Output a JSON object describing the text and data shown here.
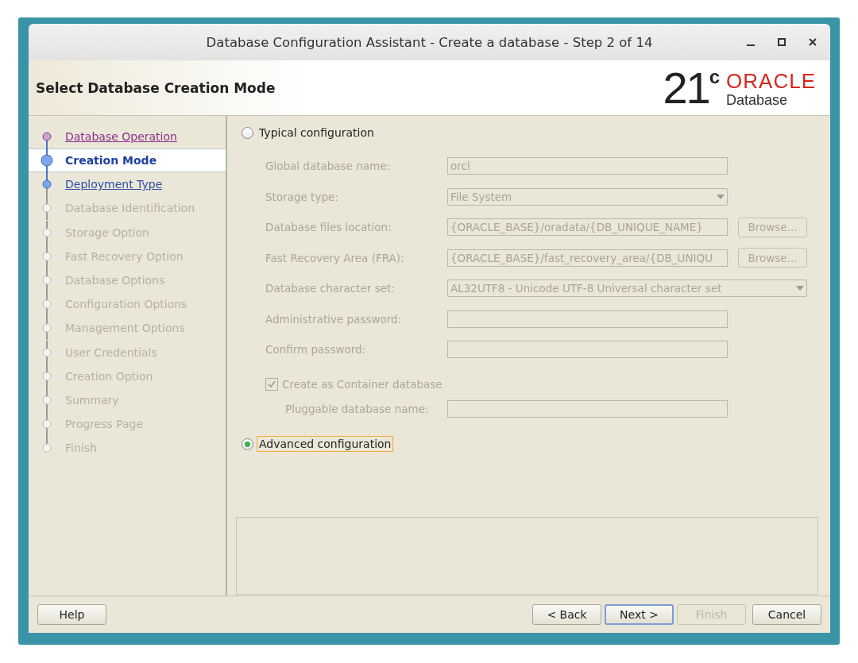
{
  "window": {
    "title": "Database Configuration Assistant - Create a database - Step 2 of 14"
  },
  "header": {
    "title": "Select Database Creation Mode",
    "logo": {
      "version": "21",
      "superscript": "c",
      "brand": "ORACLE",
      "product": "Database"
    }
  },
  "steps": [
    {
      "label": "Database Operation",
      "selected": false,
      "visited": true,
      "disabled": false
    },
    {
      "label": "Creation Mode",
      "selected": true,
      "visited": false,
      "disabled": false
    },
    {
      "label": "Deployment Type",
      "selected": false,
      "visited": false,
      "disabled": false
    },
    {
      "label": "Database Identification",
      "selected": false,
      "visited": false,
      "disabled": true
    },
    {
      "label": "Storage Option",
      "selected": false,
      "visited": false,
      "disabled": true
    },
    {
      "label": "Fast Recovery Option",
      "selected": false,
      "visited": false,
      "disabled": true
    },
    {
      "label": "Database Options",
      "selected": false,
      "visited": false,
      "disabled": true
    },
    {
      "label": "Configuration Options",
      "selected": false,
      "visited": false,
      "disabled": true
    },
    {
      "label": "Management Options",
      "selected": false,
      "visited": false,
      "disabled": true
    },
    {
      "label": "User Credentials",
      "selected": false,
      "visited": false,
      "disabled": true
    },
    {
      "label": "Creation Option",
      "selected": false,
      "visited": false,
      "disabled": true
    },
    {
      "label": "Summary",
      "selected": false,
      "visited": false,
      "disabled": true
    },
    {
      "label": "Progress Page",
      "selected": false,
      "visited": false,
      "disabled": true
    },
    {
      "label": "Finish",
      "selected": false,
      "visited": false,
      "disabled": true
    }
  ],
  "modes": [
    {
      "label": "Typical configuration",
      "selected": false,
      "focused": false
    },
    {
      "label": "Advanced configuration",
      "selected": true,
      "focused": true
    }
  ],
  "typical_fields": [
    {
      "kind": "text",
      "label": "Global database name:",
      "value": "orcl",
      "disabled": true
    },
    {
      "kind": "dropdown",
      "label": "Storage type:",
      "value": "File System",
      "disabled": true
    },
    {
      "kind": "path",
      "label": "Database files location:",
      "value": "{ORACLE_BASE}/oradata/{DB_UNIQUE_NAME}",
      "button": "Browse...",
      "disabled": true
    },
    {
      "kind": "path",
      "label": "Fast Recovery Area (FRA):",
      "value": "{ORACLE_BASE}/fast_recovery_area/{DB_UNIQU",
      "button": "Browse...",
      "disabled": true
    },
    {
      "kind": "wide-dropdown",
      "label": "Database character set:",
      "value": "AL32UTF8 - Unicode UTF-8 Universal character set",
      "disabled": true
    },
    {
      "kind": "password",
      "label": "Administrative password:",
      "disabled": true
    },
    {
      "kind": "password",
      "label": "Confirm password:",
      "disabled": true
    }
  ],
  "container": {
    "label": "Create as Container database",
    "checked": true,
    "disabled": true,
    "pluggable_label": "Pluggable database name:"
  },
  "buttons": [
    {
      "label": "Help",
      "kind": "left",
      "disabled": false,
      "default": false
    },
    {
      "label": "< Back",
      "kind": "right",
      "disabled": false,
      "default": false
    },
    {
      "label": "Next >",
      "kind": "right",
      "disabled": false,
      "default": true
    },
    {
      "label": "Finish",
      "kind": "right",
      "disabled": true,
      "default": false
    },
    {
      "label": "Cancel",
      "kind": "right",
      "disabled": false,
      "default": false
    }
  ]
}
